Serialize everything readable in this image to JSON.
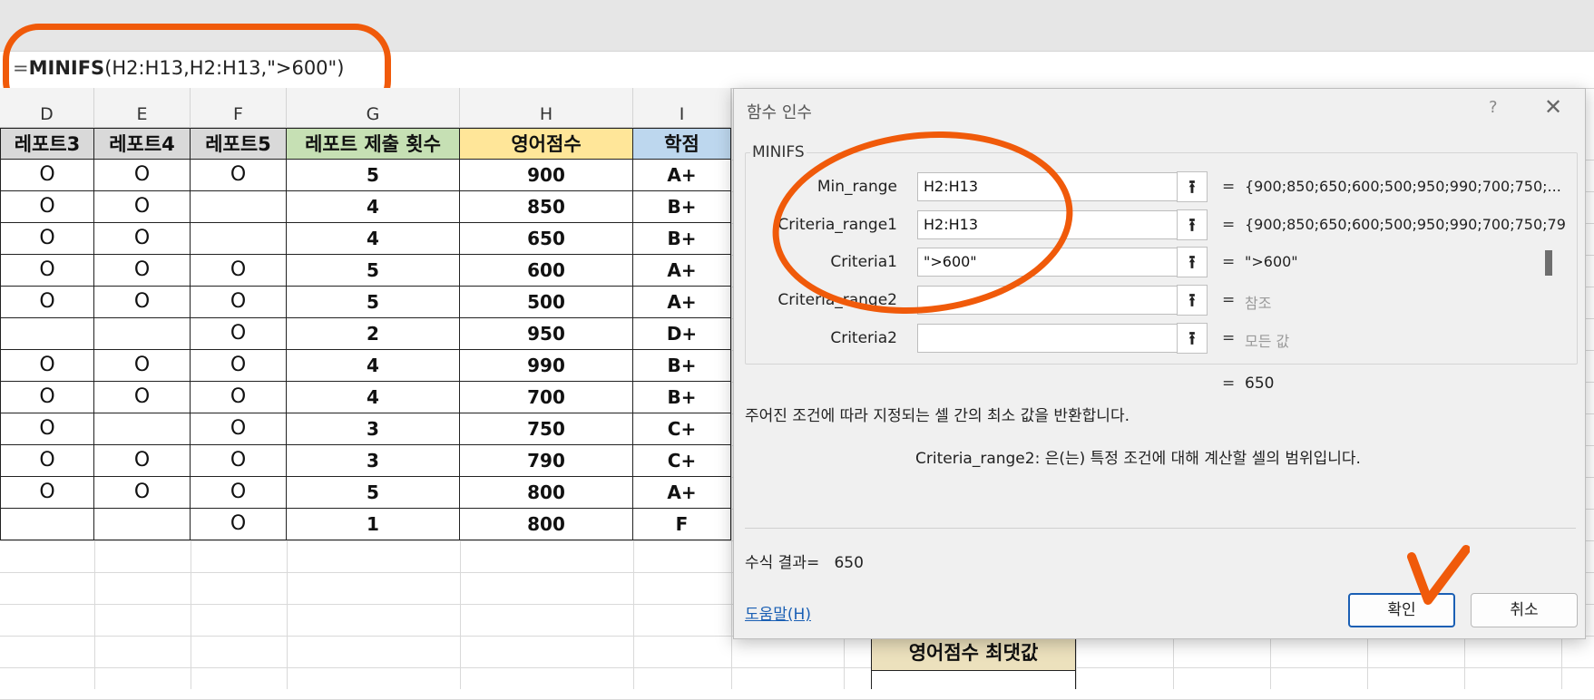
{
  "formula_bar": {
    "eq": "=",
    "fn": "MINIFS",
    "args": "(H2:H13,H2:H13,\">600\")"
  },
  "columns": [
    "D",
    "E",
    "F",
    "G",
    "H",
    "I"
  ],
  "table": {
    "headers": [
      "레포트3",
      "레포트4",
      "레포트5",
      "레포트 제출 횟수",
      "영어점수",
      "학점"
    ],
    "header_colors": [
      "#d9d9d9",
      "#d9d9d9",
      "#d9d9d9",
      "#c6e0b4",
      "#ffe699",
      "#bdd7ee"
    ],
    "rows": [
      [
        "O",
        "O",
        "O",
        "5",
        "900",
        "A+"
      ],
      [
        "O",
        "O",
        "",
        "4",
        "850",
        "B+"
      ],
      [
        "O",
        "O",
        "",
        "4",
        "650",
        "B+"
      ],
      [
        "O",
        "O",
        "O",
        "5",
        "600",
        "A+"
      ],
      [
        "O",
        "O",
        "O",
        "5",
        "500",
        "A+"
      ],
      [
        "",
        "",
        "O",
        "2",
        "950",
        "D+"
      ],
      [
        "O",
        "O",
        "O",
        "4",
        "990",
        "B+"
      ],
      [
        "O",
        "O",
        "O",
        "4",
        "700",
        "B+"
      ],
      [
        "O",
        "",
        "O",
        "3",
        "750",
        "C+"
      ],
      [
        "O",
        "O",
        "O",
        "3",
        "790",
        "C+"
      ],
      [
        "O",
        "O",
        "O",
        "5",
        "800",
        "A+"
      ],
      [
        "",
        "",
        "O",
        "1",
        "800",
        "F"
      ]
    ]
  },
  "max_label": "영어점수 최댓값",
  "dialog": {
    "title": "함수 인수",
    "help_icon": "?",
    "close_icon": "✕",
    "group_name": "MINIFS",
    "args": [
      {
        "label": "Min_range",
        "input": "H2:H13",
        "value": "{900;850;650;600;500;950;990;700;750;...",
        "dim": false
      },
      {
        "label": "Criteria_range1",
        "input": "H2:H13",
        "value": "{900;850;650;600;500;950;990;700;750;79",
        "dim": false
      },
      {
        "label": "Criteria1",
        "input": "\">600\"",
        "value": "\">600\"",
        "dim": false
      },
      {
        "label": "Criteria_range2",
        "input": "",
        "value": "참조",
        "dim": true
      },
      {
        "label": "Criteria2",
        "input": "",
        "value": "모든 값",
        "dim": true
      }
    ],
    "eq_sign": "=",
    "result_value": "650",
    "description": "주어진 조건에 따라 지정되는 셀 간의 최소 값을 반환합니다.",
    "arg_description": "Criteria_range2:  은(는) 특정 조건에 대해 계산할 셀의 범위입니다.",
    "formula_result_label": "수식 결과=",
    "formula_result_value": "650",
    "help_link": "도움말(H)",
    "ok_label": "확인",
    "cancel_label": "취소"
  },
  "annotation_color": "#f05a0a"
}
